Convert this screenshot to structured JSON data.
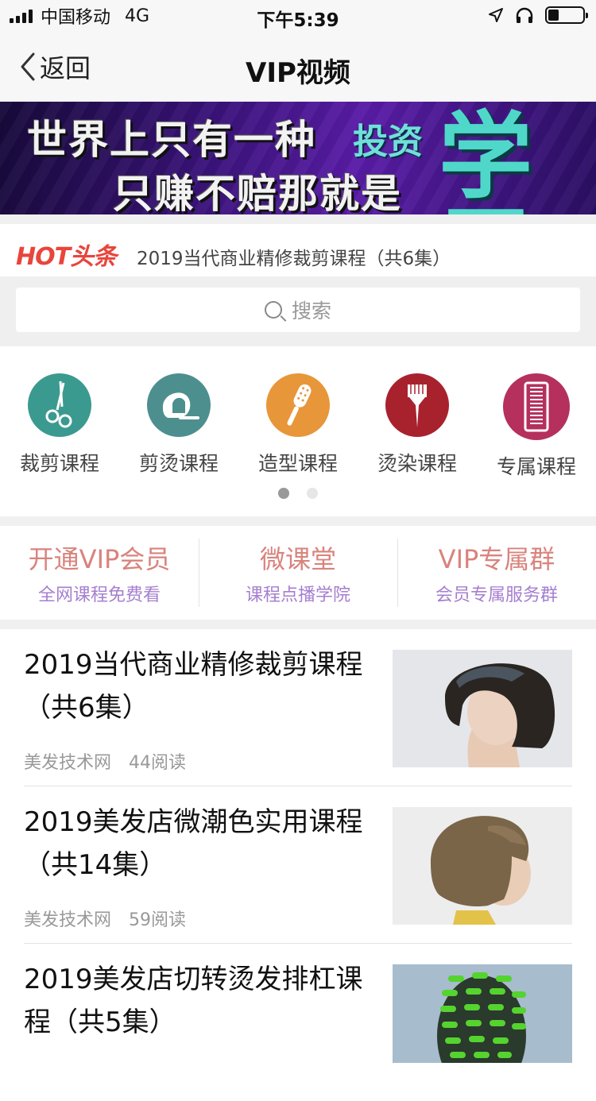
{
  "status_bar": {
    "carrier": "中国移动",
    "network": "4G",
    "time": "下午5:39"
  },
  "nav": {
    "back_label": "返回",
    "title": "VIP视频"
  },
  "banner": {
    "line1": "世界上只有一种",
    "accent1": "投资",
    "line2": "只赚不赔那就是",
    "accent2": "学习"
  },
  "hot": {
    "logo": "HOT头条",
    "headline": "2019当代商业精修裁剪课程（共6集）"
  },
  "search": {
    "placeholder": "搜索"
  },
  "categories": {
    "items": [
      {
        "label": "裁剪课程",
        "icon": "scissors-icon",
        "color": "#3b9a8f"
      },
      {
        "label": "剪烫课程",
        "icon": "hair-head-icon",
        "color": "#4d8f8e"
      },
      {
        "label": "造型课程",
        "icon": "round-brush-icon",
        "color": "#e8963a"
      },
      {
        "label": "烫染课程",
        "icon": "dye-brush-icon",
        "color": "#a8222e"
      },
      {
        "label": "专属课程",
        "icon": "comb-icon",
        "color": "#b5305c"
      }
    ],
    "page_index": 1,
    "page_count": 2
  },
  "features": {
    "items": [
      {
        "title": "开通VIP会员",
        "subtitle": "全网课程免费看"
      },
      {
        "title": "微课堂",
        "subtitle": "课程点播学院"
      },
      {
        "title": "VIP专属群",
        "subtitle": "会员专属服务群"
      }
    ]
  },
  "articles": {
    "items": [
      {
        "title": "2019当代商业精修裁剪课程（共6集）",
        "source": "美发技术网",
        "reads": "44阅读",
        "thumb": "bob-haircut-photo"
      },
      {
        "title": "2019美发店微潮色实用课程（共14集）",
        "source": "美发技术网",
        "reads": "59阅读",
        "thumb": "brown-bob-photo"
      },
      {
        "title": "2019美发店切转烫发排杠课程（共5集）",
        "source": "",
        "reads": "",
        "thumb": "perm-rods-photo"
      }
    ]
  }
}
